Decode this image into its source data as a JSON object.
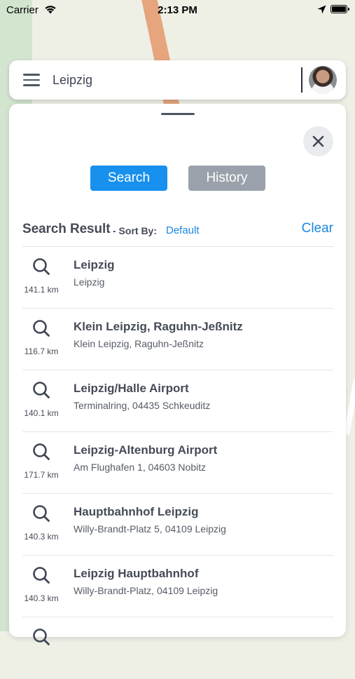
{
  "status_bar": {
    "carrier": "Carrier",
    "time": "2:13 PM"
  },
  "search_bar": {
    "query": "Leipzig"
  },
  "tabs": {
    "search": "Search",
    "history": "History"
  },
  "results": {
    "title": "Search Result",
    "sort_by_label": "- Sort By:",
    "sort_value": "Default",
    "clear_label": "Clear",
    "items": [
      {
        "name": "Leipzig",
        "address": "Leipzig",
        "distance": "141.1 km"
      },
      {
        "name": "Klein Leipzig, Raguhn-Jeßnitz",
        "address": "Klein Leipzig, Raguhn-Jeßnitz",
        "distance": "116.7 km"
      },
      {
        "name": "Leipzig/Halle Airport",
        "address": "Terminalring, 04435 Schkeuditz",
        "distance": "140.1 km"
      },
      {
        "name": "Leipzig-Altenburg Airport",
        "address": "Am Flughafen 1, 04603 Nobitz",
        "distance": "171.7 km"
      },
      {
        "name": "Hauptbahnhof Leipzig",
        "address": "Willy-Brandt-Platz 5, 04109 Leipzig",
        "distance": "140.3 km"
      },
      {
        "name": "Leipzig Hauptbahnhof",
        "address": "Willy-Brandt-Platz, 04109 Leipzig",
        "distance": "140.3 km"
      }
    ]
  },
  "colors": {
    "accent": "#1890ee",
    "inactive_tab": "#9aa1ab",
    "text": "#454b57"
  }
}
